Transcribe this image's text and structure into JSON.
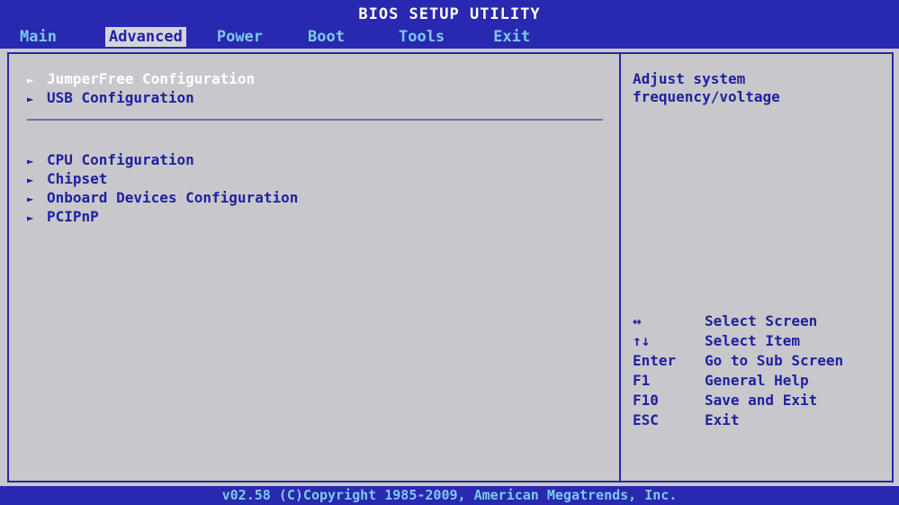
{
  "title": "BIOS SETUP UTILITY",
  "tabs": [
    {
      "label": "Main"
    },
    {
      "label": "Advanced"
    },
    {
      "label": "Power"
    },
    {
      "label": "Boot"
    },
    {
      "label": "Tools"
    },
    {
      "label": "Exit"
    }
  ],
  "active_tab": "Advanced",
  "menu_group1": [
    {
      "arrow": "►",
      "label": "JumperFree Configuration",
      "selected": true
    },
    {
      "arrow": "►",
      "label": "USB Configuration",
      "selected": false
    }
  ],
  "menu_group2": [
    {
      "arrow": "►",
      "label": "CPU Configuration"
    },
    {
      "arrow": "►",
      "label": "Chipset"
    },
    {
      "arrow": "►",
      "label": "Onboard Devices Configuration"
    },
    {
      "arrow": "►",
      "label": "PCIPnP"
    }
  ],
  "help": {
    "line1": "Adjust system",
    "line2": "frequency/voltage"
  },
  "keys": [
    {
      "key": "↔",
      "desc": "Select Screen"
    },
    {
      "key": "↑↓",
      "desc": "Select Item"
    },
    {
      "key": "Enter",
      "desc": "Go to Sub Screen"
    },
    {
      "key": "F1",
      "desc": "General Help"
    },
    {
      "key": "F10",
      "desc": "Save and Exit"
    },
    {
      "key": "ESC",
      "desc": "Exit"
    }
  ],
  "footer": "v02.58 (C)Copyright 1985-2009, American Megatrends, Inc.",
  "colors": {
    "bar_blue": "#2828b0",
    "panel_gray": "#c8c8cc",
    "text_blue": "#2020a0",
    "tab_text": "#7fc8e8",
    "selected_text": "#ffffff"
  }
}
